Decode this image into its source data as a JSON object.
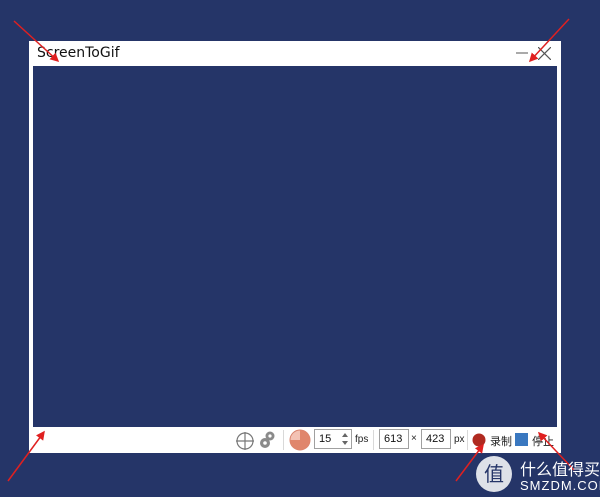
{
  "window": {
    "title": "ScreenToGif",
    "buttons": {
      "minimize_icon": "minimize-icon",
      "close_icon": "close-icon"
    }
  },
  "toolbar": {
    "snap_icon": "crosshair-icon",
    "options_icon": "gears-icon",
    "frequency_icon": "pie-clock-icon",
    "fps_value": "15",
    "fps_unit": "fps",
    "width_value": "613",
    "times": "×",
    "height_value": "423",
    "px_unit": "px",
    "record_label": "录制",
    "stop_label": "停止"
  },
  "watermark": {
    "logo_char": "值",
    "cn_text": "什么值得买",
    "en_text": "SMZDM.COM"
  },
  "colors": {
    "background": "#253568",
    "record": "#b02a20",
    "stop": "#3a78c0",
    "arrow": "#e02020"
  }
}
